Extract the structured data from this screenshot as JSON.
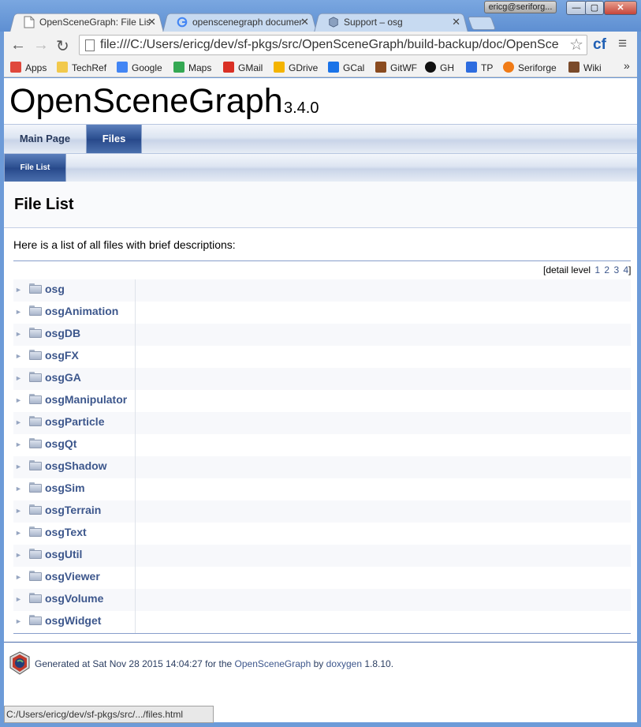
{
  "browser": {
    "tabs": [
      {
        "label": "OpenSceneGraph: File List",
        "active": true,
        "icon": "page-icon"
      },
      {
        "label": "openscenegraph documen",
        "active": false,
        "icon": "google-icon"
      },
      {
        "label": "Support – osg",
        "active": false,
        "icon": "osg-icon"
      }
    ],
    "close_glyph": "✕",
    "profile": "ericg@seriforg...",
    "window_buttons": {
      "minimize": "—",
      "maximize": "▢",
      "close": "✕"
    },
    "nav": {
      "back": "←",
      "forward": "→",
      "reload": "↻"
    },
    "url": "file:///C:/Users/ericg/dev/sf-pkgs/src/OpenSceneGraph/build-backup/doc/OpenSce",
    "star": "☆",
    "extension": "cf",
    "menu": "≡",
    "bookmarks": [
      {
        "label": "Apps",
        "color": "#e0483c"
      },
      {
        "label": "TechRef",
        "color": "#f2c94c"
      },
      {
        "label": "Google",
        "color": "#4285f4"
      },
      {
        "label": "Maps",
        "color": "#34a853"
      },
      {
        "label": "GMail",
        "color": "#d93025"
      },
      {
        "label": "GDrive",
        "color": "#f4b400"
      },
      {
        "label": "GCal",
        "color": "#1a73e8"
      },
      {
        "label": "GitWF",
        "color": "#8a4b1f"
      },
      {
        "label": "GH",
        "color": "#111111"
      },
      {
        "label": "TP",
        "color": "#2d6cdf"
      },
      {
        "label": "Seriforge",
        "color": "#f07b16"
      },
      {
        "label": "Wiki",
        "color": "#7a4a2a"
      }
    ],
    "bookmarks_more": "»",
    "status_url": "C:/Users/ericg/dev/sf-pkgs/src/.../files.html"
  },
  "page": {
    "project_name": "OpenSceneGraph",
    "project_number": "3.4.0",
    "nav_tabs": [
      {
        "label": "Main Page",
        "selected": false
      },
      {
        "label": "Files",
        "selected": true
      }
    ],
    "sub_tabs": [
      {
        "label": "File List",
        "selected": true
      }
    ],
    "title": "File List",
    "intro": "Here is a list of all files with brief descriptions:",
    "detail_level": {
      "prefix": "[detail level",
      "levels": [
        "1",
        "2",
        "3",
        "4"
      ],
      "suffix": "]"
    },
    "tree_arrow": "►",
    "folders": [
      "osg",
      "osgAnimation",
      "osgDB",
      "osgFX",
      "osgGA",
      "osgManipulator",
      "osgParticle",
      "osgQt",
      "osgShadow",
      "osgSim",
      "osgTerrain",
      "osgText",
      "osgUtil",
      "osgViewer",
      "osgVolume",
      "osgWidget"
    ],
    "footer": {
      "generated": "Generated at Sat Nov 28 2015 14:04:27 for the",
      "project_link": "OpenSceneGraph",
      "by": "by",
      "tool_link": "doxygen",
      "version": "1.8.10."
    }
  }
}
